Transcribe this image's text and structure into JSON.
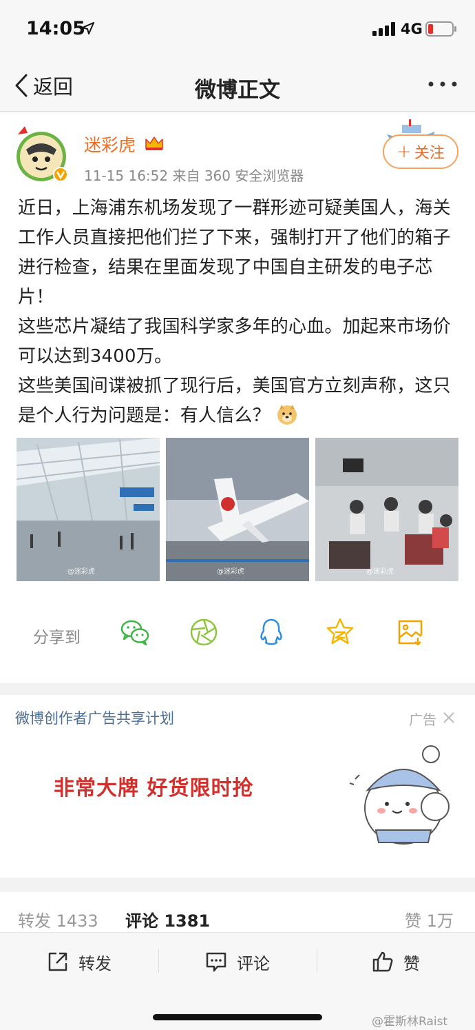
{
  "status_bar": {
    "time": "14:05",
    "network": "4G"
  },
  "nav": {
    "back_label": "返回",
    "title": "微博正文"
  },
  "post": {
    "author": "迷彩虎",
    "meta": "11-15 16:52  来自 360 安全浏览器",
    "follow_label": "关注",
    "paragraphs": [
      "近日，上海浦东机场发现了一群形迹可疑美国人，海关工作人员直接把他们拦了下来，强制打开了他们的箱子进行检查，结果在里面发现了中国自主研发的电子芯片！",
      "这些芯片凝结了我国科学家多年的心血。加起来市场价可以达到3400万。",
      "这些美国间谍被抓了现行后，美国官方立刻声称，这只是个人行为问题是：有人信么？"
    ],
    "photos": [
      {
        "name": "airport-terminal",
        "watermark": "@迷彩虎"
      },
      {
        "name": "air-china-plane",
        "watermark": "@迷彩虎"
      },
      {
        "name": "luggage-inspection",
        "watermark": "@迷彩虎"
      }
    ]
  },
  "share": {
    "label": "分享到",
    "targets": [
      "wechat-icon",
      "moments-icon",
      "qq-icon",
      "qzone-icon",
      "save-image-icon"
    ]
  },
  "ad": {
    "plan_link": "微博创作者广告共享计划",
    "tag": "广告",
    "slogan": "非常大牌  好货限时抢"
  },
  "stats": {
    "repost": "转发 1433",
    "comment": "评论 1381",
    "like": "赞 1万"
  },
  "actions": {
    "repost": "转发",
    "comment": "评论",
    "like": "赞"
  },
  "watermark": "@霍斯林Raist",
  "colors": {
    "accent": "#f26c1f",
    "link": "#4b6e96",
    "ad_red": "#d0312d",
    "share_green": "#3fb548",
    "share_yellow": "#f5b600",
    "share_blue": "#2e8dde"
  }
}
